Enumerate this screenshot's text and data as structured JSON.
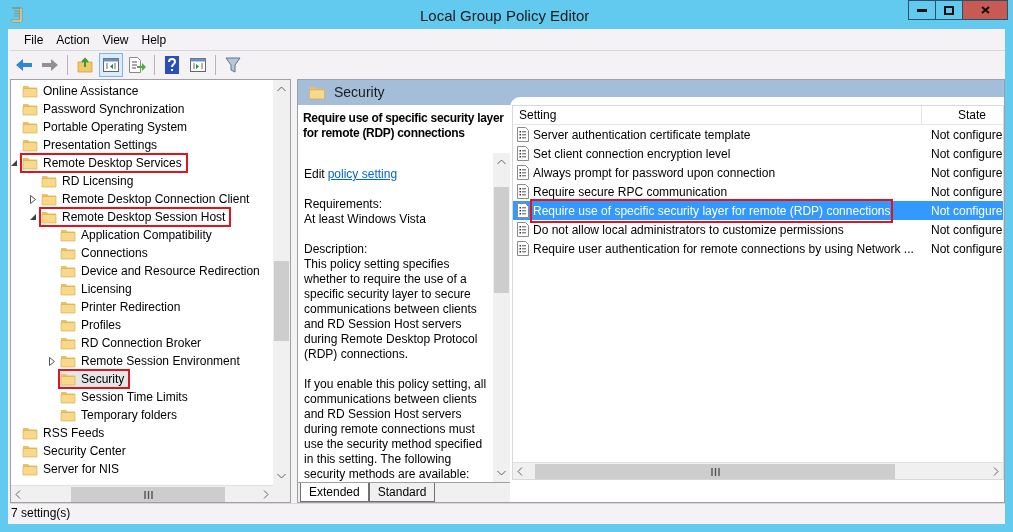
{
  "window": {
    "title": "Local Group Policy Editor"
  },
  "menu": [
    "File",
    "Action",
    "View",
    "Help"
  ],
  "toolbar": [
    {
      "disabled": false,
      "pressed": false
    },
    {
      "disabled": true,
      "pressed": false
    },
    {
      "disabled": false,
      "pressed": false
    },
    {
      "disabled": false,
      "pressed": true
    },
    {
      "disabled": false,
      "pressed": false
    },
    {
      "disabled": false,
      "pressed": false
    },
    {
      "disabled": false,
      "pressed": false
    },
    {
      "disabled": false,
      "pressed": false
    }
  ],
  "tree": [
    {
      "label": "Online Assistance",
      "has_children": false,
      "expanded": false,
      "selected": false,
      "highlighted": false
    },
    {
      "label": "Password Synchronization",
      "has_children": false,
      "expanded": false,
      "selected": false,
      "highlighted": false
    },
    {
      "label": "Portable Operating System",
      "has_children": false,
      "expanded": false,
      "selected": false,
      "highlighted": false
    },
    {
      "label": "Presentation Settings",
      "has_children": false,
      "expanded": false,
      "selected": false,
      "highlighted": false
    },
    {
      "label": "Remote Desktop Services",
      "has_children": true,
      "expanded": true,
      "selected": false,
      "highlighted": true,
      "children": [
        {
          "label": "RD Licensing",
          "has_children": false,
          "expanded": false,
          "selected": false,
          "highlighted": false
        },
        {
          "label": "Remote Desktop Connection Client",
          "has_children": true,
          "expanded": false,
          "selected": false,
          "highlighted": false
        },
        {
          "label": "Remote Desktop Session Host",
          "has_children": true,
          "expanded": true,
          "selected": false,
          "highlighted": true,
          "children": [
            {
              "label": "Application Compatibility",
              "has_children": false,
              "expanded": false,
              "selected": false,
              "highlighted": false
            },
            {
              "label": "Connections",
              "has_children": false,
              "expanded": false,
              "selected": false,
              "highlighted": false
            },
            {
              "label": "Device and Resource Redirection",
              "has_children": false,
              "expanded": false,
              "selected": false,
              "highlighted": false
            },
            {
              "label": "Licensing",
              "has_children": false,
              "expanded": false,
              "selected": false,
              "highlighted": false
            },
            {
              "label": "Printer Redirection",
              "has_children": false,
              "expanded": false,
              "selected": false,
              "highlighted": false
            },
            {
              "label": "Profiles",
              "has_children": false,
              "expanded": false,
              "selected": false,
              "highlighted": false
            },
            {
              "label": "RD Connection Broker",
              "has_children": false,
              "expanded": false,
              "selected": false,
              "highlighted": false
            },
            {
              "label": "Remote Session Environment",
              "has_children": true,
              "expanded": false,
              "selected": false,
              "highlighted": false
            },
            {
              "label": "Security",
              "has_children": false,
              "expanded": false,
              "selected": true,
              "highlighted": true
            },
            {
              "label": "Session Time Limits",
              "has_children": false,
              "expanded": false,
              "selected": false,
              "highlighted": false
            },
            {
              "label": "Temporary folders",
              "has_children": false,
              "expanded": false,
              "selected": false,
              "highlighted": false
            }
          ]
        }
      ]
    },
    {
      "label": "RSS Feeds",
      "has_children": false,
      "expanded": false,
      "selected": false,
      "highlighted": false
    },
    {
      "label": "Security Center",
      "has_children": false,
      "expanded": false,
      "selected": false,
      "highlighted": false
    },
    {
      "label": "Server for NIS",
      "has_children": false,
      "expanded": false,
      "selected": false,
      "highlighted": false
    }
  ],
  "details": {
    "folder": "Security",
    "title": "Require use of specific security layer for remote (RDP) connections",
    "edit_prefix": "Edit",
    "edit_link": "policy setting",
    "paragraphs": [
      [
        "Requirements:",
        "At least Windows Vista"
      ],
      [
        "Description:",
        "This policy setting specifies",
        "whether to require the use of a",
        "specific security layer to secure",
        "communications between clients",
        "and RD Session Host servers",
        "during Remote Desktop Protocol",
        "(RDP) connections."
      ],
      [
        "If you enable this policy setting, all",
        "communications between clients",
        "and RD Session Host servers",
        "during remote connections must",
        "use the security method specified",
        "in this setting. The following",
        "security methods are available:"
      ]
    ],
    "tabs": [
      {
        "label": "Extended",
        "selected": true
      },
      {
        "label": "Standard",
        "selected": false
      }
    ]
  },
  "list": {
    "columns": [
      "Setting",
      "State"
    ],
    "rows": [
      {
        "setting": "Server authentication certificate template",
        "state": "Not configure",
        "selected": false,
        "highlighted": false
      },
      {
        "setting": "Set client connection encryption level",
        "state": "Not configure",
        "selected": false,
        "highlighted": false
      },
      {
        "setting": "Always prompt for password upon connection",
        "state": "Not configure",
        "selected": false,
        "highlighted": false
      },
      {
        "setting": "Require secure RPC communication",
        "state": "Not configure",
        "selected": false,
        "highlighted": false
      },
      {
        "setting": "Require use of specific security layer for remote (RDP) connections",
        "state": "Not configure",
        "selected": true,
        "highlighted": true
      },
      {
        "setting": "Do not allow local administrators to customize permissions",
        "state": "Not configure",
        "selected": false,
        "highlighted": false
      },
      {
        "setting": "Require user authentication for remote connections by using Network ...",
        "state": "Not configure",
        "selected": false,
        "highlighted": false
      }
    ]
  },
  "status_bar": "7 setting(s)"
}
